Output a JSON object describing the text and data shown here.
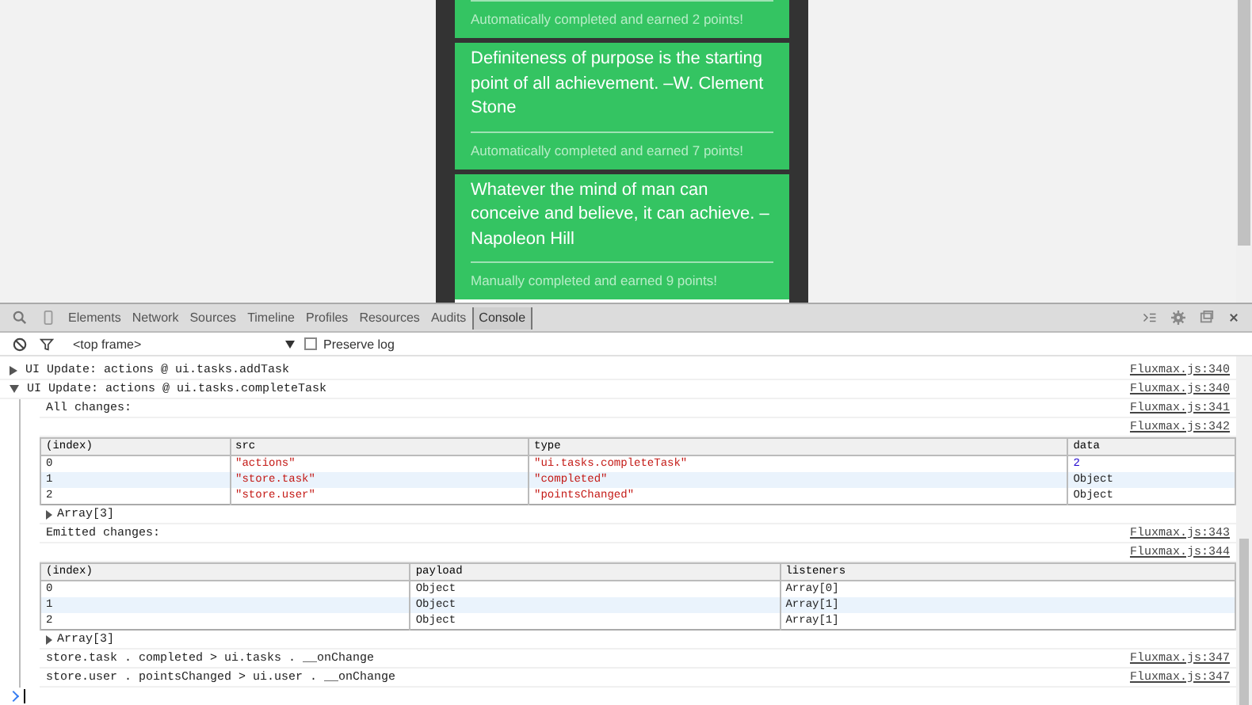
{
  "app": {
    "cards": [
      {
        "status": "Automatically completed and earned 2 points!"
      },
      {
        "quote": "Definiteness of purpose is the starting point of all achievement. –W. Clement Stone",
        "status": "Automatically completed and earned 7 points!"
      },
      {
        "quote": "Whatever the mind of man can conceive and believe, it can achieve. –Napoleon Hill",
        "status": "Manually completed and earned 9 points!"
      }
    ]
  },
  "devtools": {
    "tabs": [
      {
        "label": "Elements",
        "selected": false
      },
      {
        "label": "Network",
        "selected": false
      },
      {
        "label": "Sources",
        "selected": false
      },
      {
        "label": "Timeline",
        "selected": false
      },
      {
        "label": "Profiles",
        "selected": false
      },
      {
        "label": "Resources",
        "selected": false
      },
      {
        "label": "Audits",
        "selected": false
      },
      {
        "label": "Console",
        "selected": true
      }
    ],
    "frame": "<top frame>",
    "preserve_log": {
      "label": "Preserve log",
      "checked": false
    },
    "entries": [
      {
        "kind": "group",
        "expanded": false,
        "text": "UI Update: actions @ ui.tasks.addTask",
        "source": "Fluxmax.js:340"
      },
      {
        "kind": "group",
        "expanded": true,
        "text": "UI Update: actions @ ui.tasks.completeTask",
        "source": "Fluxmax.js:340",
        "children": [
          {
            "kind": "log",
            "text": "All changes:",
            "source": "Fluxmax.js:341"
          },
          {
            "kind": "table",
            "source": "Fluxmax.js:342",
            "columns": [
              "(index)",
              "src",
              "type",
              "data"
            ],
            "rows": [
              {
                "selected": false,
                "cells": [
                  {
                    "text": "0",
                    "color": "#222222"
                  },
                  {
                    "text": "\"actions\"",
                    "color": "#c41a16"
                  },
                  {
                    "text": "\"ui.tasks.completeTask\"",
                    "color": "#c41a16"
                  },
                  {
                    "text": "2",
                    "color": "#1c00cf"
                  }
                ]
              },
              {
                "selected": true,
                "cells": [
                  {
                    "text": "1",
                    "color": "#222222"
                  },
                  {
                    "text": "\"store.task\"",
                    "color": "#c41a16"
                  },
                  {
                    "text": "\"completed\"",
                    "color": "#c41a16"
                  },
                  {
                    "text": "Object",
                    "color": "#222222"
                  }
                ]
              },
              {
                "selected": false,
                "cells": [
                  {
                    "text": "2",
                    "color": "#222222"
                  },
                  {
                    "text": "\"store.user\"",
                    "color": "#c41a16"
                  },
                  {
                    "text": "\"pointsChanged\"",
                    "color": "#c41a16"
                  },
                  {
                    "text": "Object",
                    "color": "#222222"
                  }
                ]
              }
            ],
            "footer": "Array[3]"
          },
          {
            "kind": "log",
            "text": "Emitted changes:",
            "source": "Fluxmax.js:343"
          },
          {
            "kind": "table",
            "source": "Fluxmax.js:344",
            "columns": [
              "(index)",
              "payload",
              "listeners"
            ],
            "rows": [
              {
                "selected": false,
                "cells": [
                  {
                    "text": "0",
                    "color": "#222222"
                  },
                  {
                    "text": "Object",
                    "color": "#222222"
                  },
                  {
                    "text": "Array[0]",
                    "color": "#222222"
                  }
                ]
              },
              {
                "selected": true,
                "cells": [
                  {
                    "text": "1",
                    "color": "#222222"
                  },
                  {
                    "text": "Object",
                    "color": "#222222"
                  },
                  {
                    "text": "Array[1]",
                    "color": "#222222"
                  }
                ]
              },
              {
                "selected": false,
                "cells": [
                  {
                    "text": "2",
                    "color": "#222222"
                  },
                  {
                    "text": "Object",
                    "color": "#222222"
                  },
                  {
                    "text": "Array[1]",
                    "color": "#222222"
                  }
                ]
              }
            ],
            "footer": "Array[3]"
          },
          {
            "kind": "log",
            "text": "store.task . completed > ui.tasks . __onChange",
            "source": "Fluxmax.js:347"
          },
          {
            "kind": "log",
            "text": "store.user . pointsChanged > ui.user . __onChange",
            "source": "Fluxmax.js:347"
          }
        ]
      }
    ]
  }
}
